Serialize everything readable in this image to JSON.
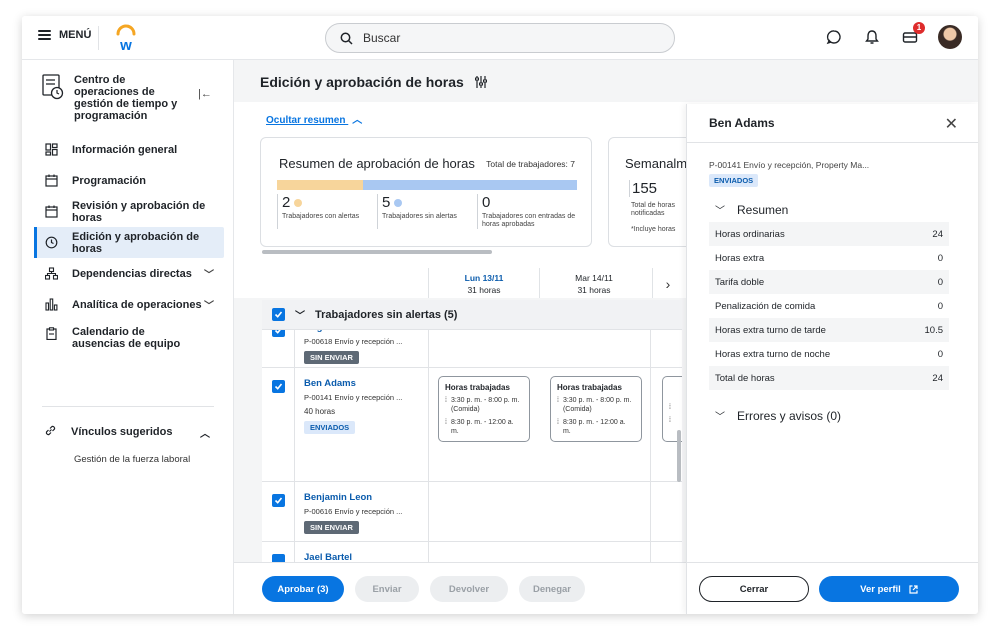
{
  "topbar": {
    "menu_label": "MENÚ",
    "search_placeholder": "Buscar",
    "notification_count": "1"
  },
  "sidebar": {
    "title": "Centro de operaciones de gestión de tiempo y programación",
    "items": [
      {
        "label": "Información general"
      },
      {
        "label": "Programación"
      },
      {
        "label": "Revisión y aprobación de horas"
      },
      {
        "label": "Edición y aprobación de horas"
      },
      {
        "label": "Dependencias directas"
      },
      {
        "label": "Analítica de operaciones"
      },
      {
        "label": "Calendario de ausencias de equipo"
      }
    ],
    "links_title": "Vínculos sugeridos",
    "links": [
      "Gestión de la fuerza laboral"
    ]
  },
  "main": {
    "page_title": "Edición y aprobación de horas",
    "hide_summary": "Ocultar resumen",
    "summary": {
      "title": "Resumen de aprobación de horas",
      "total": "Total de trabajadores: 7",
      "alerts_fraction": 0.286,
      "stats": [
        {
          "value": "2",
          "label": "Trabajadores con alertas",
          "color": "#f7d59b"
        },
        {
          "value": "5",
          "label": "Trabajadores sin alertas",
          "color": "#a9c8f2"
        },
        {
          "value": "0",
          "label": "Trabajadores con entradas de horas aprobadas"
        }
      ]
    },
    "weekly": {
      "title": "Semanalm",
      "value": "155",
      "label": "Total de horas notificadas",
      "note": "*Incluye horas"
    },
    "columns": [
      {
        "day": "Lun 13/11",
        "hours": "31 horas"
      },
      {
        "day": "Mar 14/11",
        "hours": "31 horas"
      }
    ],
    "group_title": "Trabajadores sin alertas (5)",
    "workers": [
      {
        "name": "Angela Chiodrass",
        "position": "P-00618 Envío y recepción ...",
        "hours": "",
        "status": "SIN ENVIAR"
      },
      {
        "name": "Ben Adams",
        "position": "P-00141 Envío y recepción ...",
        "hours": "40 horas",
        "status": "ENVIADOS"
      },
      {
        "name": "Benjamin Leon",
        "position": "P-00616 Envío y recepción ...",
        "hours": "",
        "status": "SIN ENVIAR"
      },
      {
        "name": "Jael Bartel",
        "position": "",
        "hours": "",
        "status": ""
      }
    ],
    "shift": {
      "title": "Horas trabajadas",
      "entry1": "3:30 p. m. - 8:00 p. m. (Comida)",
      "entry2": "8:30 p. m. - 12:00 a. m."
    },
    "actions": {
      "approve": "Aprobar (3)",
      "send": "Enviar",
      "return": "Devolver",
      "deny": "Denegar"
    }
  },
  "panel": {
    "name": "Ben Adams",
    "position": "P-00141 Envío y recepción, Property Ma...",
    "status": "ENVIADOS",
    "summary_label": "Resumen",
    "rows": [
      {
        "label": "Horas ordinarias",
        "value": "24"
      },
      {
        "label": "Horas extra",
        "value": "0"
      },
      {
        "label": "Tarifa doble",
        "value": "0"
      },
      {
        "label": "Penalización de comida",
        "value": "0"
      },
      {
        "label": "Horas extra turno de tarde",
        "value": "10.5"
      },
      {
        "label": "Horas extra turno de noche",
        "value": "0"
      },
      {
        "label": "Total de horas",
        "value": "24"
      }
    ],
    "errors_label": "Errores y avisos (0)",
    "close_label": "Cerrar",
    "profile_label": "Ver perfil"
  },
  "colors": {
    "accent": "#0875e1",
    "alerts": "#f7d59b",
    "no_alerts": "#a9c8f2",
    "link": "#0b5cad",
    "tag_dark": "#5e6975"
  }
}
